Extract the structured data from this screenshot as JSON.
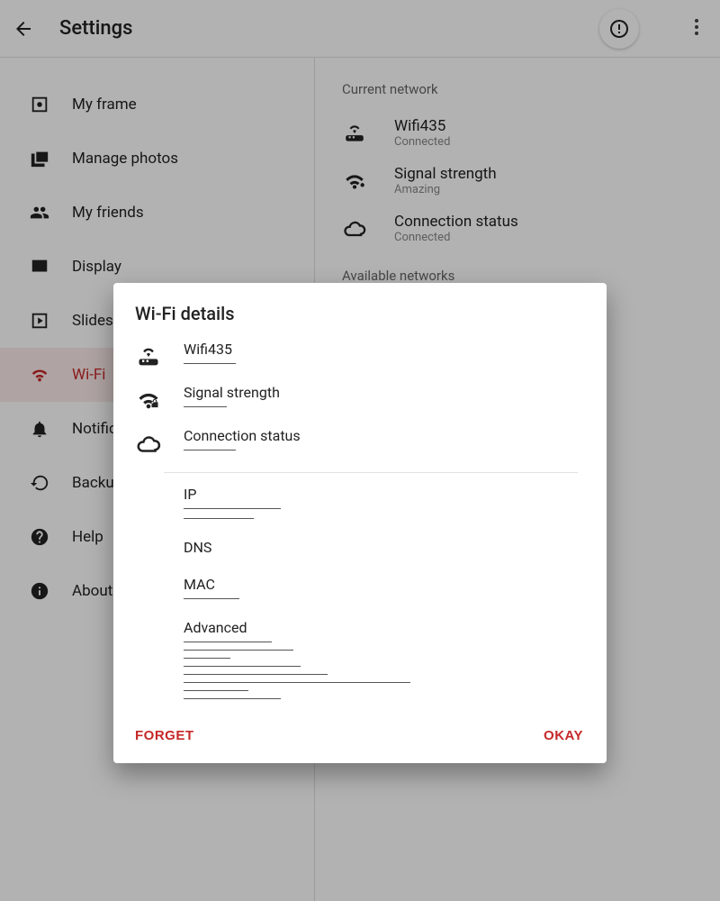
{
  "header": {
    "title": "Settings"
  },
  "sidebar": {
    "items": [
      {
        "label": "My frame"
      },
      {
        "label": "Manage photos"
      },
      {
        "label": "My friends"
      },
      {
        "label": "Display"
      },
      {
        "label": "Slideshow"
      },
      {
        "label": "Wi-Fi"
      },
      {
        "label": "Notifications"
      },
      {
        "label": "Backup and Restore"
      },
      {
        "label": "Help"
      },
      {
        "label": "About"
      }
    ]
  },
  "main": {
    "section": "Current network",
    "ssid": {
      "title": "Wifi435",
      "sub": "Connected"
    },
    "signal": {
      "title": "Signal strength",
      "sub": "Amazing"
    },
    "status": {
      "title": "Connection status",
      "sub": "Connected"
    },
    "avail": "Available networks"
  },
  "modal": {
    "title": "Wi-Fi details",
    "rows": {
      "ssid": "Wifi435",
      "signal": "Signal strength",
      "status": "Connection status",
      "ip": "IP",
      "dns": "DNS",
      "mac": "MAC",
      "advanced": "Advanced"
    },
    "actions": {
      "forget": "FORGET",
      "ok": "OKAY"
    }
  }
}
